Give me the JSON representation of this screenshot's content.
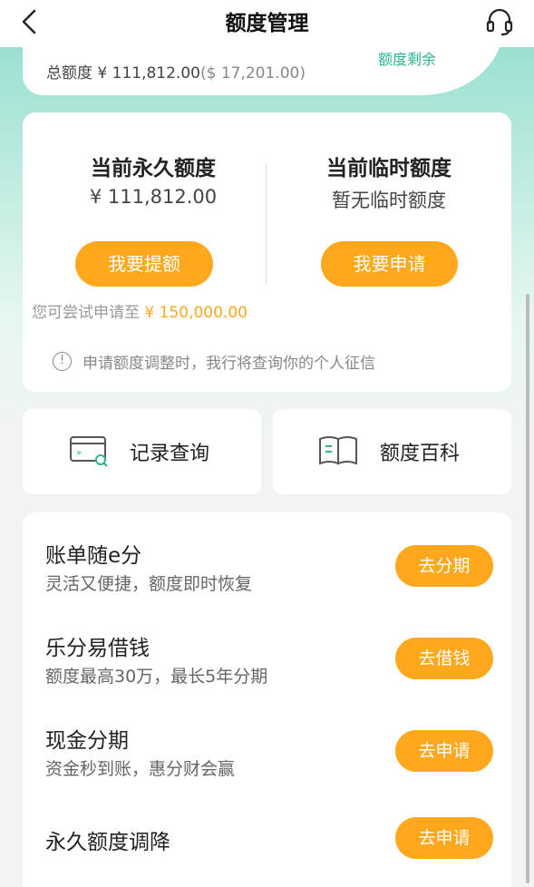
{
  "nav": {
    "title": "额度管理",
    "back_icon": "chevron-left-icon",
    "service_icon": "headset-icon"
  },
  "total": {
    "label": "总额度 ¥ 111,812.00",
    "usd": "($ 17,201.00)",
    "remain_label": "额度剩余"
  },
  "quota": {
    "permanent": {
      "title": "当前永久额度",
      "value": "¥ 111,812.00",
      "button": "我要提额"
    },
    "temporary": {
      "title": "当前临时额度",
      "value": "暂无临时额度",
      "button": "我要申请"
    },
    "hint_prefix": "您可尝试申请至 ",
    "hint_amount": "¥ 150,000.00",
    "notice": "申请额度调整时，我行将查询你的个人征信"
  },
  "quick": [
    {
      "label": "记录查询",
      "icon": "record-search-icon"
    },
    {
      "label": "额度百科",
      "icon": "book-icon"
    }
  ],
  "list": [
    {
      "title": "账单随e分",
      "subtitle": "灵活又便捷，额度即时恢复",
      "button": "去分期"
    },
    {
      "title": "乐分易借钱",
      "subtitle": "额度最高30万，最长5年分期",
      "button": "去借钱"
    },
    {
      "title": "现金分期",
      "subtitle": "资金秒到账，惠分财会赢",
      "button": "去申请"
    },
    {
      "title": "永久额度调降",
      "subtitle": "",
      "button": "去申请"
    }
  ],
  "colors": {
    "accent_orange": "#ffa81e",
    "accent_teal": "#2bb494"
  }
}
